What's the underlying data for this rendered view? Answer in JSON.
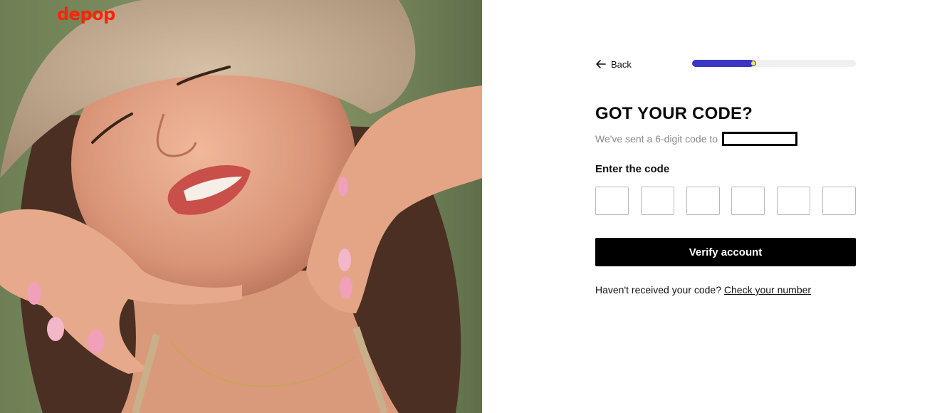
{
  "brand": {
    "logo_text": "depop",
    "logo_color": "#ff2300"
  },
  "photo": {
    "alt": "",
    "subject": "woman-in-bucket-hat-photo"
  },
  "nav": {
    "back_label": "Back",
    "back_icon": "arrow-left-icon"
  },
  "progress": {
    "fraction": 0.38,
    "fill_color": "#3b36c4",
    "dot_color": "#f7e84a"
  },
  "heading": {
    "title": "GOT YOUR CODE?",
    "subtitle": "We've sent a 6-digit code to"
  },
  "code": {
    "label": "Enter the code",
    "digits": [
      "",
      "",
      "",
      "",
      "",
      ""
    ]
  },
  "actions": {
    "verify_label": "Verify account"
  },
  "help": {
    "prompt": "Haven't received your code?",
    "link": "Check your number"
  }
}
